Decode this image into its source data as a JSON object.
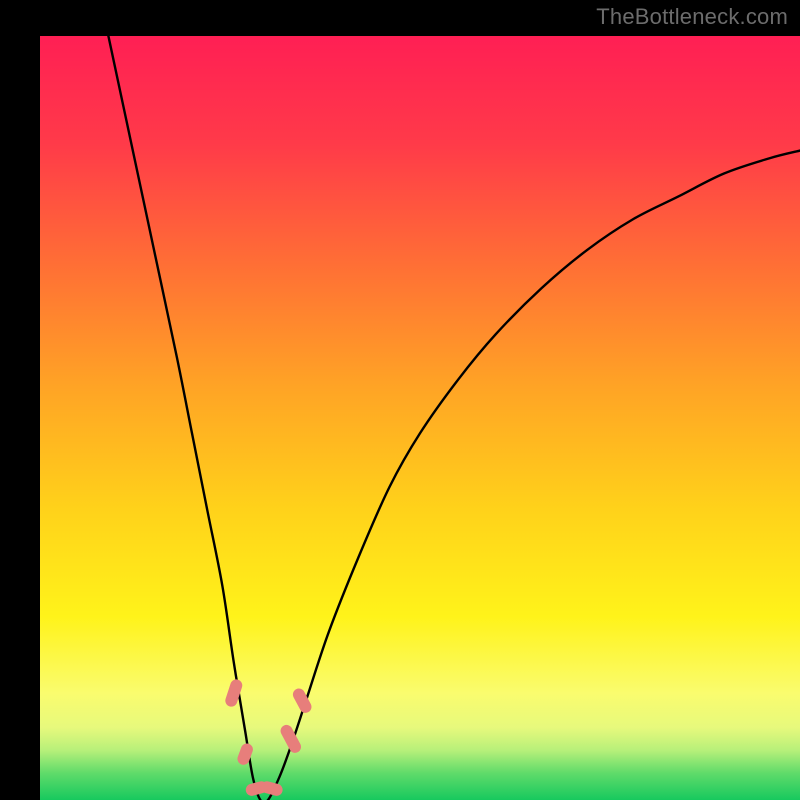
{
  "watermark": "TheBottleneck.com",
  "chart_data": {
    "type": "line",
    "title": "",
    "xlabel": "",
    "ylabel": "",
    "xlim": [
      0,
      100
    ],
    "ylim": [
      0,
      100
    ],
    "grid": false,
    "series": [
      {
        "name": "bottleneck-curve",
        "x": [
          9,
          12,
          15,
          18,
          20,
          22,
          24,
          25.5,
          27,
          28,
          29,
          30,
          31.5,
          33,
          35,
          38,
          42,
          46,
          50,
          55,
          60,
          66,
          72,
          78,
          84,
          90,
          96,
          100
        ],
        "y": [
          100,
          86,
          72,
          58,
          48,
          38,
          28,
          18,
          9,
          3,
          0,
          0,
          3,
          7,
          13,
          22,
          32,
          41,
          48,
          55,
          61,
          67,
          72,
          76,
          79,
          82,
          84,
          85
        ]
      }
    ],
    "markers": {
      "name": "highlight-pills",
      "color": "#e77e7b",
      "points": [
        {
          "x": 25.5,
          "y": 14,
          "angle": -72,
          "len": 28
        },
        {
          "x": 27.0,
          "y": 6,
          "angle": -70,
          "len": 22
        },
        {
          "x": 28.5,
          "y": 1.5,
          "angle": -15,
          "len": 22
        },
        {
          "x": 30.5,
          "y": 1.5,
          "angle": 15,
          "len": 22
        },
        {
          "x": 33.0,
          "y": 8,
          "angle": 62,
          "len": 30
        },
        {
          "x": 34.5,
          "y": 13,
          "angle": 62,
          "len": 26
        }
      ]
    },
    "gradient_stops": [
      {
        "pos": 0.0,
        "color": "#ff1f54"
      },
      {
        "pos": 0.14,
        "color": "#ff3a49"
      },
      {
        "pos": 0.3,
        "color": "#ff6f35"
      },
      {
        "pos": 0.46,
        "color": "#ffa425"
      },
      {
        "pos": 0.62,
        "color": "#ffd21a"
      },
      {
        "pos": 0.76,
        "color": "#fff31a"
      },
      {
        "pos": 0.86,
        "color": "#fafc6e"
      },
      {
        "pos": 0.905,
        "color": "#e7f97c"
      },
      {
        "pos": 0.935,
        "color": "#b7f07a"
      },
      {
        "pos": 0.965,
        "color": "#5fdb6a"
      },
      {
        "pos": 1.0,
        "color": "#17c95e"
      }
    ]
  }
}
